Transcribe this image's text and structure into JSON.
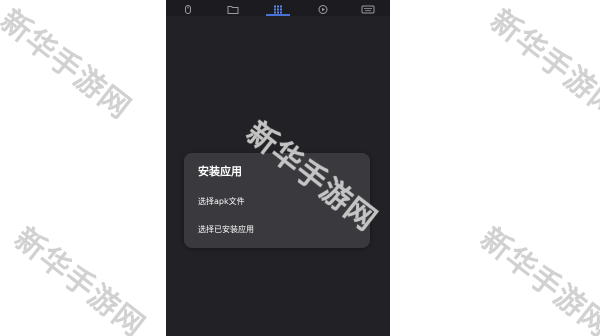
{
  "watermark": {
    "text": "新华手游网"
  },
  "tabs": [
    {
      "icon": "mouse-icon"
    },
    {
      "icon": "folder-icon"
    },
    {
      "icon": "apps-grid-icon",
      "active": true
    },
    {
      "icon": "play-icon"
    },
    {
      "icon": "keyboard-icon"
    }
  ],
  "dialog": {
    "title": "安装应用",
    "options": [
      {
        "label": "选择apk文件"
      },
      {
        "label": "选择已安装应用"
      }
    ]
  },
  "colors": {
    "background": "#222226",
    "dialog": "#3a3a3e",
    "accent": "#4a73d9",
    "watermark": "#cfcfcf"
  }
}
